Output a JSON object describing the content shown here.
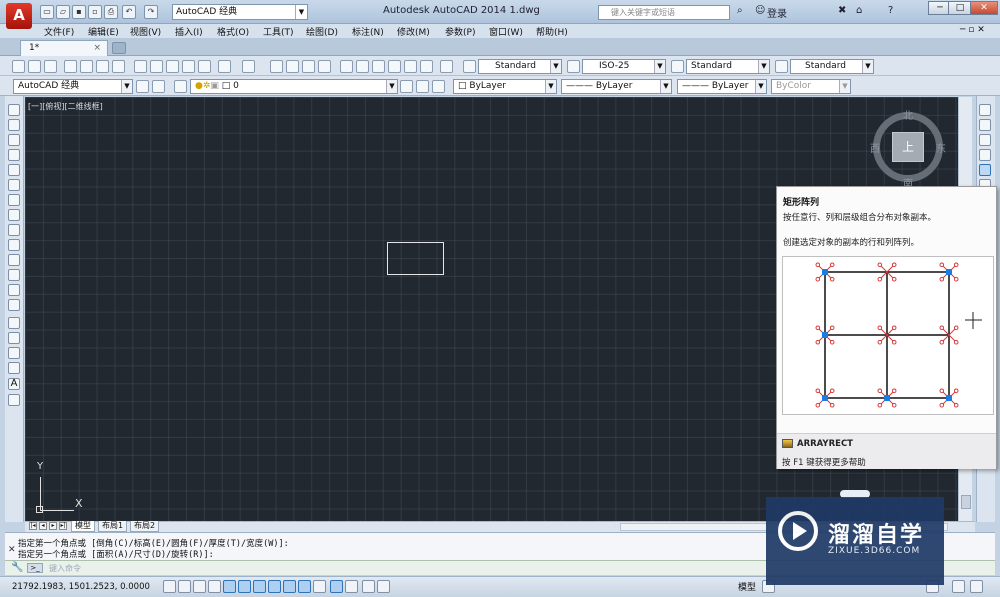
{
  "app": {
    "title": "Autodesk AutoCAD 2014    1.dwg",
    "workspace": "AutoCAD 经典",
    "search_placeholder": "键入关键字或短语",
    "login": "登录",
    "logo_letter": "A"
  },
  "menu": [
    "文件(F)",
    "编辑(E)",
    "视图(V)",
    "插入(I)",
    "格式(O)",
    "工具(T)",
    "绘图(D)",
    "标注(N)",
    "修改(M)",
    "参数(P)",
    "窗口(W)",
    "帮助(H)"
  ],
  "doc_tab": {
    "label": "1*",
    "close": "×"
  },
  "styles_toolbar": {
    "text_style": "Standard",
    "dim_style": "ISO-25",
    "table_style": "Standard",
    "mleader_style": "Standard"
  },
  "layers_toolbar": {
    "workspace": "AutoCAD 经典",
    "layer": "0",
    "color": "ByLayer",
    "linetype": "——— ByLayer",
    "lineweight": "——— ByLayer",
    "plotstyle": "ByColor"
  },
  "viewport": {
    "label": "[一][俯视][二维线框]",
    "viewcube": {
      "top": "上",
      "north": "北",
      "south": "南",
      "east": "东",
      "west": "西"
    },
    "ucs": {
      "x": "X",
      "y": "Y"
    }
  },
  "layout_tabs": [
    "模型",
    "布局1",
    "布局2"
  ],
  "command": {
    "history": [
      "指定第一个角点或 [倒角(C)/标高(E)/圆角(F)/厚度(T)/宽度(W)]:",
      "指定另一个角点或 [面积(A)/尺寸(D)/旋转(R)]:"
    ],
    "placeholder": "键入命令"
  },
  "status": {
    "coords": "21792.1983,  1501.2523,  0.0000",
    "model": "模型"
  },
  "tooltip": {
    "title": "矩形阵列",
    "description": "按任意行、列和层级组合分布对象副本。",
    "detail": "创建选定对象的副本的行和列阵列。",
    "command": "ARRAYRECT",
    "help": "按 F1 键获得更多帮助"
  },
  "watermark": {
    "text": "溜溜自学",
    "url": "ZIXUE.3D66.COM"
  },
  "colors": {
    "canvas": "#212830",
    "accent": "#c0201a",
    "grip": "#1e7be0",
    "grip_marker": "#d43a3a"
  },
  "icons": [
    "app-menu-icon",
    "new-icon",
    "open-icon",
    "save-icon",
    "print-icon",
    "undo-icon",
    "redo-icon",
    "line-icon",
    "circle-icon",
    "array-icon",
    "pan-icon",
    "zoom-icon"
  ]
}
